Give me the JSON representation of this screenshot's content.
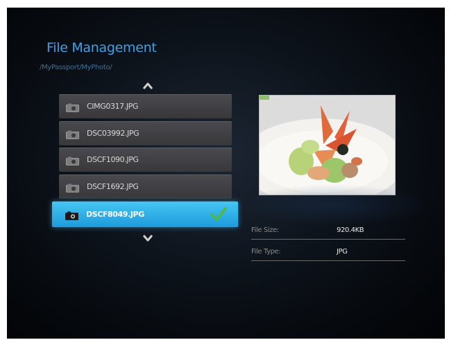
{
  "header": {
    "title": "File Management",
    "path": "/MyPassport/MyPhoto/"
  },
  "file_list": {
    "items": [
      {
        "name": "CIMG0317.JPG",
        "selected": false
      },
      {
        "name": "DSC03992.JPG",
        "selected": false
      },
      {
        "name": "DSCF1090.JPG",
        "selected": false
      },
      {
        "name": "DSCF1692.JPG",
        "selected": false
      },
      {
        "name": "DSCF8049.JPG",
        "selected": true
      }
    ]
  },
  "details": {
    "file_size_label": "File Size:",
    "file_size_value": "920.4KB",
    "file_type_label": "File Type:",
    "file_type_value": "JPG"
  },
  "icons": {
    "scroll_up": "chevron-up-icon",
    "scroll_down": "chevron-down-icon",
    "file": "camera-icon",
    "selected_mark": "checkmark-icon"
  },
  "colors": {
    "accent": "#1e9bdc",
    "title": "#3fa0e8",
    "check": "#4fb848"
  }
}
